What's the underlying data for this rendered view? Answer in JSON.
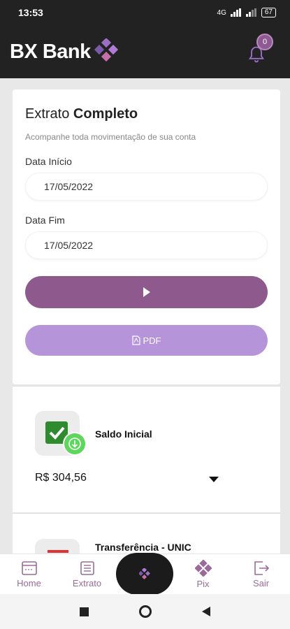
{
  "status_bar": {
    "time": "13:53",
    "signal": "4G",
    "battery": "67"
  },
  "header": {
    "brand": "BX Bank",
    "notifications_count": "0"
  },
  "statement": {
    "title_light": "Extrato",
    "title_bold": "Completo",
    "subtitle": "Acompanhe toda movimentação de sua conta",
    "start_label": "Data Início",
    "start_value": "17/05/2022",
    "end_label": "Data Fim",
    "end_value": "17/05/2022",
    "pdf_label": "PDF"
  },
  "transactions": [
    {
      "title": "Saldo Inicial",
      "amount": "R$ 304,56"
    },
    {
      "title": "Transferência - UNIC"
    }
  ],
  "bottom_nav": {
    "home": "Home",
    "extrato": "Extrato",
    "pix": "Pix",
    "sair": "Sair"
  },
  "colors": {
    "primary": "#8e5a8e",
    "pdf_button": "#b594d9",
    "header_bg": "#222222",
    "success": "#2e8b2e"
  }
}
